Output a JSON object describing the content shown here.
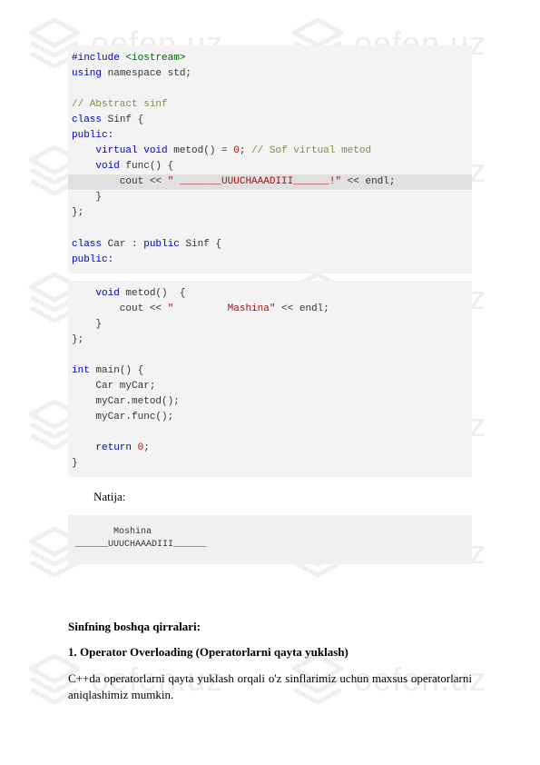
{
  "watermark": {
    "text": "oefen.uz"
  },
  "code1": {
    "l1a": "#include",
    "l1b": " <iostream>",
    "l2a": "using",
    "l2b": " namespace std;",
    "l3": "// Abstract sinf",
    "l4a": "class",
    "l4b": " Sinf {",
    "l5": "public:",
    "l6a": "    virtual void",
    "l6b": " metod() = ",
    "l6c": "0",
    "l6d": ";",
    "l6e": " // Sof virtual metod",
    "l7a": "    void",
    "l7b": " func() {",
    "l8a": "        cout << ",
    "l8b": "\" _______UUUCHAAADIII______!\"",
    "l8c": " << endl;",
    "l9": "    }",
    "l10": "};",
    "l11a": "class",
    "l11b": " Car : ",
    "l11c": "public",
    "l11d": " Sinf {",
    "l12": "public:"
  },
  "code2": {
    "l1a": "    void",
    "l1b": " metod()  {",
    "l2a": "        cout << ",
    "l2b": "\"         Mashina\"",
    "l2c": " << endl;",
    "l3": "    }",
    "l4": "};",
    "l5a": "int",
    "l5b": " main() {",
    "l6": "    Car myCar;",
    "l7": "    myCar.metod();",
    "l8": "    myCar.func();",
    "l9a": "    return",
    "l9b": " ",
    "l9c": "0",
    "l9d": ";",
    "l10": "}"
  },
  "natija_label": "Natija:",
  "output": {
    "l1": "       Moshina",
    "l2": "______UUUCHAAADIII______"
  },
  "text": {
    "heading1": "Sinfning boshqa qirralari:",
    "heading2": "1. Operator Overloading (Operatorlarni qayta yuklash)",
    "para": "C++da operatorlarni qayta yuklash orqali o'z sinflarimiz uchun maxsus operatorlarni aniqlashimiz mumkin."
  }
}
